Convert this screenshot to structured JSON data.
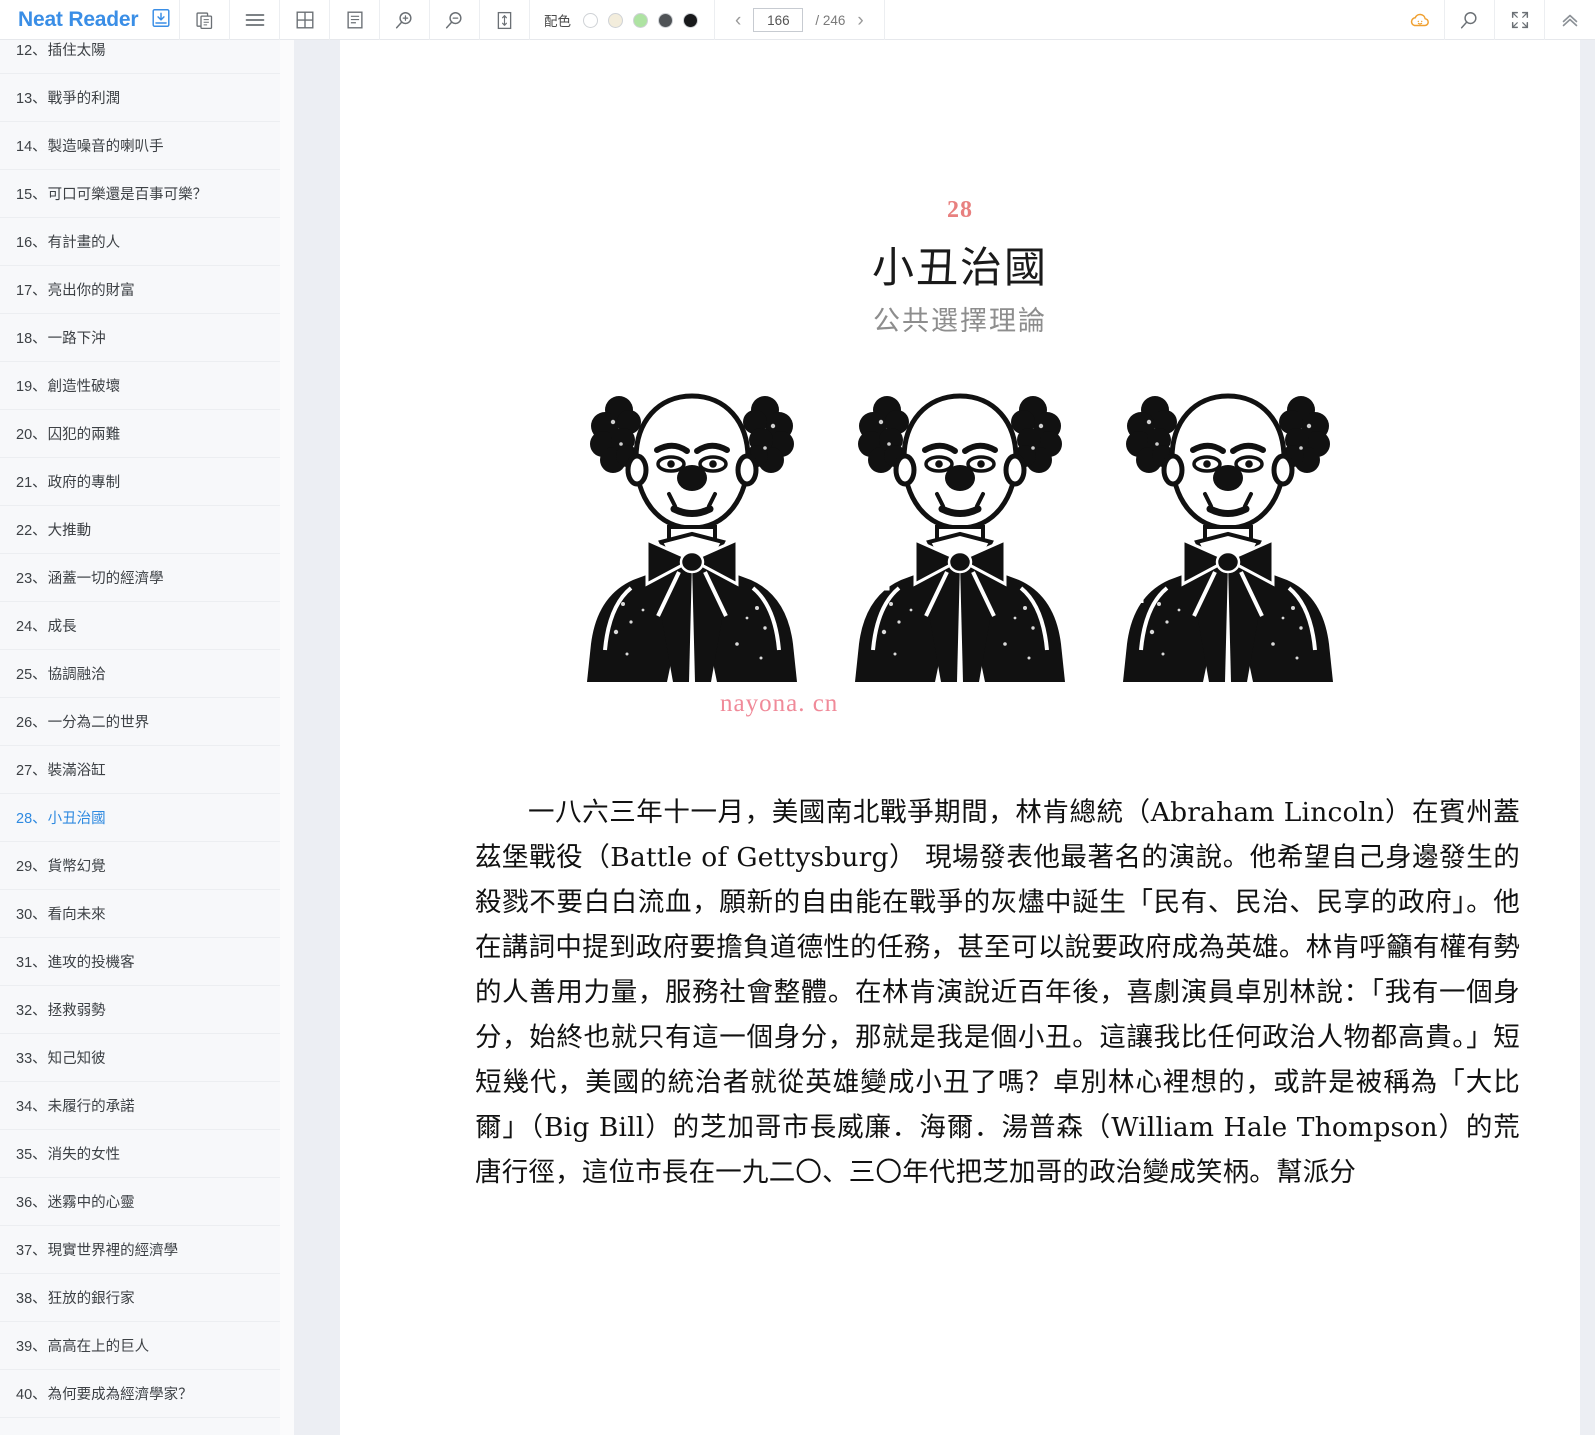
{
  "app": {
    "brand": "Neat Reader",
    "brand_color": "#3a8ee6"
  },
  "toolbar": {
    "icons": [
      {
        "name": "save-to-library-icon",
        "label": "save-to-library"
      },
      {
        "name": "copy-icon",
        "label": "copy"
      },
      {
        "name": "menu-icon",
        "label": "menu"
      },
      {
        "name": "grid-layout-icon",
        "label": "grid-layout"
      },
      {
        "name": "page-layout-icon",
        "label": "page-layout"
      },
      {
        "name": "zoom-in-icon",
        "label": "zoom-in"
      },
      {
        "name": "zoom-out-icon",
        "label": "zoom-out"
      },
      {
        "name": "fit-height-icon",
        "label": "fit-height"
      }
    ],
    "palette_label": "配色",
    "palette_swatches": [
      "#ffffff",
      "#f3eddc",
      "#aee3a2",
      "#4f5356",
      "#18191b"
    ],
    "pager": {
      "prev": "‹",
      "next": "›",
      "current_page": "166",
      "total": "/ 246"
    },
    "right_icons": [
      {
        "name": "cloud-sync-icon",
        "label": "cloud-sync",
        "color": "#f0a030"
      },
      {
        "name": "search-icon",
        "label": "search"
      },
      {
        "name": "fullscreen-icon",
        "label": "fullscreen"
      },
      {
        "name": "collapse-toolbar-icon",
        "label": "collapse-toolbar"
      }
    ]
  },
  "sidebar": {
    "items": [
      {
        "num": "12、",
        "title": "插住太陽",
        "active": false
      },
      {
        "num": "13、",
        "title": "戰爭的利潤",
        "active": false
      },
      {
        "num": "14、",
        "title": "製造噪音的喇叭手",
        "active": false
      },
      {
        "num": "15、",
        "title": "可口可樂還是百事可樂？",
        "active": false
      },
      {
        "num": "16、",
        "title": "有計畫的人",
        "active": false
      },
      {
        "num": "17、",
        "title": "亮出你的財富",
        "active": false
      },
      {
        "num": "18、",
        "title": "一路下沖",
        "active": false
      },
      {
        "num": "19、",
        "title": "創造性破壞",
        "active": false
      },
      {
        "num": "20、",
        "title": "囚犯的兩難",
        "active": false
      },
      {
        "num": "21、",
        "title": "政府的專制",
        "active": false
      },
      {
        "num": "22、",
        "title": "大推動",
        "active": false
      },
      {
        "num": "23、",
        "title": "涵蓋一切的經濟學",
        "active": false
      },
      {
        "num": "24、",
        "title": "成長",
        "active": false
      },
      {
        "num": "25、",
        "title": "協調融洽",
        "active": false
      },
      {
        "num": "26、",
        "title": "一分為二的世界",
        "active": false
      },
      {
        "num": "27、",
        "title": "裝滿浴缸",
        "active": false
      },
      {
        "num": "28、",
        "title": "小丑治國",
        "active": true
      },
      {
        "num": "29、",
        "title": "貨幣幻覺",
        "active": false
      },
      {
        "num": "30、",
        "title": "看向未來",
        "active": false
      },
      {
        "num": "31、",
        "title": "進攻的投機客",
        "active": false
      },
      {
        "num": "32、",
        "title": "拯救弱勢",
        "active": false
      },
      {
        "num": "33、",
        "title": "知己知彼",
        "active": false
      },
      {
        "num": "34、",
        "title": "未履行的承諾",
        "active": false
      },
      {
        "num": "35、",
        "title": "消失的女性",
        "active": false
      },
      {
        "num": "36、",
        "title": "迷霧中的心靈",
        "active": false
      },
      {
        "num": "37、",
        "title": "現實世界裡的經濟學",
        "active": false
      },
      {
        "num": "38、",
        "title": "狂放的銀行家",
        "active": false
      },
      {
        "num": "39、",
        "title": "高高在上的巨人",
        "active": false
      },
      {
        "num": "40、",
        "title": "為何要成為經濟學家？",
        "active": false
      }
    ]
  },
  "content": {
    "chapter_number": "28",
    "chapter_title": "小丑治國",
    "chapter_subtitle": "公共選擇理論",
    "figure_alt": "three-clowns-illustration",
    "watermark": "nayona. cn",
    "paragraph": "一八六三年十一月，美國南北戰爭期間，林肯總統（Abraham Lincoln）在賓州蓋茲堡戰役（Battle of Gettysburg） 現場發表他最著名的演說。他希望自己身邊發生的殺戮不要白白流血，願新的自由能在戰爭的灰燼中誕生「民有、民治、民享的政府」。他在講詞中提到政府要擔負道德性的任務，甚至可以說要政府成為英雄。林肯呼籲有權有勢的人善用力量，服務社會整體。在林肯演說近百年後，喜劇演員卓別林說：「我有一個身分，始終也就只有這一個身分，那就是我是個小丑。這讓我比任何政治人物都高貴。」短短幾代，美國的統治者就從英雄變成小丑了嗎？卓別林心裡想的，或許是被稱為「大比爾」（Big Bill）的芝加哥市長威廉．海爾．湯普森（William Hale Thompson）的荒唐行徑，這位市長在一九二〇、三〇年代把芝加哥的政治變成笑柄。幫派分"
  }
}
